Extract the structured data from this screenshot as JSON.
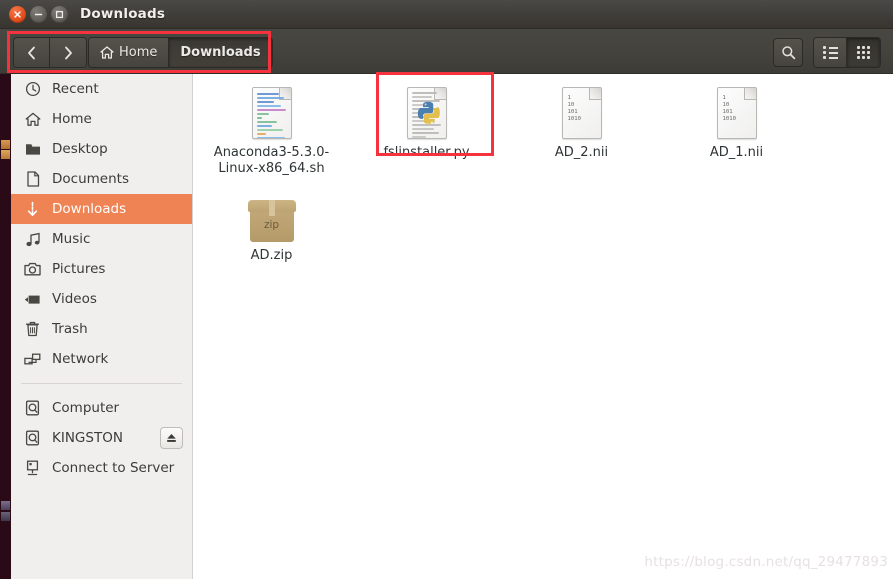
{
  "window": {
    "title": "Downloads",
    "controls": [
      {
        "name": "close",
        "glyph": "×"
      },
      {
        "name": "minimize",
        "glyph": "−"
      },
      {
        "name": "maximize",
        "glyph": "□"
      }
    ]
  },
  "toolbar": {
    "back_label": "‹",
    "forward_label": "›",
    "breadcrumbs": [
      {
        "label": "Home",
        "icon": "home-icon",
        "active": false
      },
      {
        "label": "Downloads",
        "icon": "",
        "active": true
      }
    ],
    "search_icon": "search-icon",
    "view_list_icon": "list-view-icon",
    "view_grid_icon": "grid-view-icon",
    "active_view": "grid"
  },
  "sidebar": {
    "items": [
      {
        "label": "Recent",
        "icon": "clock-icon",
        "selected": false,
        "eject": false
      },
      {
        "label": "Home",
        "icon": "home-icon",
        "selected": false,
        "eject": false
      },
      {
        "label": "Desktop",
        "icon": "folder-icon",
        "selected": false,
        "eject": false
      },
      {
        "label": "Documents",
        "icon": "document-icon",
        "selected": false,
        "eject": false
      },
      {
        "label": "Downloads",
        "icon": "download-icon",
        "selected": true,
        "eject": false
      },
      {
        "label": "Music",
        "icon": "music-icon",
        "selected": false,
        "eject": false
      },
      {
        "label": "Pictures",
        "icon": "camera-icon",
        "selected": false,
        "eject": false
      },
      {
        "label": "Videos",
        "icon": "video-icon",
        "selected": false,
        "eject": false
      },
      {
        "label": "Trash",
        "icon": "trash-icon",
        "selected": false,
        "eject": false
      },
      {
        "label": "Network",
        "icon": "network-icon",
        "selected": false,
        "eject": false
      },
      {
        "separator": true
      },
      {
        "label": "Computer",
        "icon": "drive-icon",
        "selected": false,
        "eject": false
      },
      {
        "label": "KINGSTON",
        "icon": "drive-icon",
        "selected": false,
        "eject": true
      },
      {
        "label": "Connect to Server",
        "icon": "server-icon",
        "selected": false,
        "eject": false
      }
    ]
  },
  "files": [
    {
      "name": "Anaconda3-5.3.0-Linux-x86_64.sh",
      "icon": "shell-script-icon",
      "highlighted": false
    },
    {
      "name": "fslinstaller.py",
      "icon": "python-file-icon",
      "highlighted": true
    },
    {
      "name": "AD_2.nii",
      "icon": "binary-file-icon",
      "highlighted": false
    },
    {
      "name": "AD_1.nii",
      "icon": "binary-file-icon",
      "highlighted": false
    },
    {
      "name": "AD.zip",
      "icon": "archive-icon",
      "highlighted": false
    }
  ],
  "binary_icon_lines": [
    "1",
    "10",
    "101",
    "1010"
  ],
  "archive_icon_label": "zip",
  "annotations": {
    "highlight_color": "#f5333f",
    "boxes": [
      "breadcrumb-bar",
      "fslinstaller-py-file"
    ]
  },
  "watermark": "https://blog.csdn.net/qq_29477893",
  "colors": {
    "selection": "#ef8354",
    "titlebar": "#403e3a",
    "sidebar_bg": "#f1efee",
    "file_area_bg": "#ffffff",
    "label_text": "#2e3436"
  }
}
